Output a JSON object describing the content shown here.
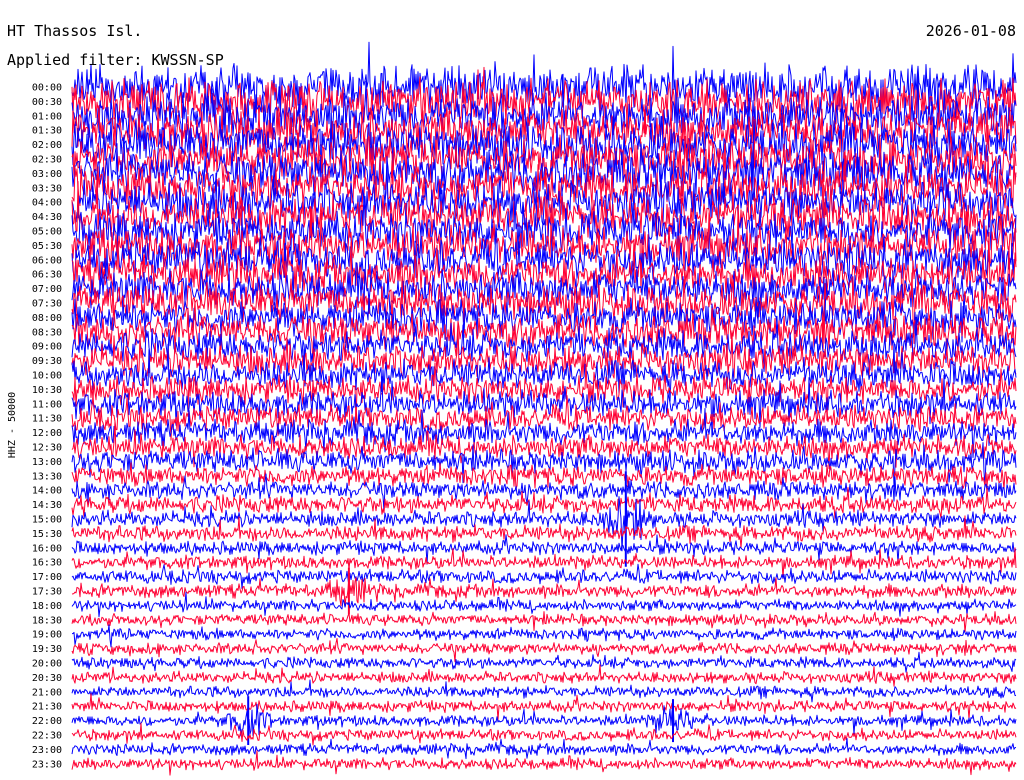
{
  "header": {
    "station": "HT Thassos Isl.",
    "date": "2026-01-08",
    "filter": "Applied filter: KWSSN-SP"
  },
  "chart_data": {
    "type": "line",
    "title": "HT Thassos Isl.",
    "ylabel": "HHZ - 50000",
    "x_range_minutes": [
      0,
      30
    ],
    "colors": [
      "#0000ff",
      "#ff0033"
    ],
    "rows": [
      {
        "label": "00:00",
        "color": "#0000ff",
        "amplitude": 0.95,
        "events": []
      },
      {
        "label": "00:30",
        "color": "#ff0033",
        "amplitude": 0.95,
        "events": []
      },
      {
        "label": "01:00",
        "color": "#0000ff",
        "amplitude": 0.95,
        "events": []
      },
      {
        "label": "01:30",
        "color": "#ff0033",
        "amplitude": 0.95,
        "events": []
      },
      {
        "label": "02:00",
        "color": "#0000ff",
        "amplitude": 0.95,
        "events": []
      },
      {
        "label": "02:30",
        "color": "#ff0033",
        "amplitude": 0.95,
        "events": []
      },
      {
        "label": "03:00",
        "color": "#0000ff",
        "amplitude": 0.95,
        "events": []
      },
      {
        "label": "03:30",
        "color": "#ff0033",
        "amplitude": 0.9,
        "events": []
      },
      {
        "label": "04:00",
        "color": "#0000ff",
        "amplitude": 0.9,
        "events": []
      },
      {
        "label": "04:30",
        "color": "#ff0033",
        "amplitude": 0.9,
        "events": []
      },
      {
        "label": "05:00",
        "color": "#0000ff",
        "amplitude": 0.85,
        "events": []
      },
      {
        "label": "05:30",
        "color": "#ff0033",
        "amplitude": 0.85,
        "events": []
      },
      {
        "label": "06:00",
        "color": "#0000ff",
        "amplitude": 0.85,
        "events": []
      },
      {
        "label": "06:30",
        "color": "#ff0033",
        "amplitude": 0.8,
        "events": []
      },
      {
        "label": "07:00",
        "color": "#0000ff",
        "amplitude": 0.8,
        "events": []
      },
      {
        "label": "07:30",
        "color": "#ff0033",
        "amplitude": 0.8,
        "events": []
      },
      {
        "label": "08:00",
        "color": "#0000ff",
        "amplitude": 0.75,
        "events": []
      },
      {
        "label": "08:30",
        "color": "#ff0033",
        "amplitude": 0.75,
        "events": []
      },
      {
        "label": "09:00",
        "color": "#0000ff",
        "amplitude": 0.7,
        "events": []
      },
      {
        "label": "09:30",
        "color": "#ff0033",
        "amplitude": 0.7,
        "events": []
      },
      {
        "label": "10:00",
        "color": "#0000ff",
        "amplitude": 0.65,
        "events": []
      },
      {
        "label": "10:30",
        "color": "#ff0033",
        "amplitude": 0.6,
        "events": []
      },
      {
        "label": "11:00",
        "color": "#0000ff",
        "amplitude": 0.6,
        "events": []
      },
      {
        "label": "11:30",
        "color": "#ff0033",
        "amplitude": 0.55,
        "events": []
      },
      {
        "label": "12:00",
        "color": "#0000ff",
        "amplitude": 0.55,
        "events": []
      },
      {
        "label": "12:30",
        "color": "#ff0033",
        "amplitude": 0.5,
        "events": []
      },
      {
        "label": "13:00",
        "color": "#0000ff",
        "amplitude": 0.5,
        "events": []
      },
      {
        "label": "13:30",
        "color": "#ff0033",
        "amplitude": 0.45,
        "events": []
      },
      {
        "label": "14:00",
        "color": "#0000ff",
        "amplitude": 0.4,
        "events": []
      },
      {
        "label": "14:30",
        "color": "#ff0033",
        "amplitude": 0.4,
        "events": []
      },
      {
        "label": "15:00",
        "color": "#0000ff",
        "amplitude": 0.35,
        "events": [
          {
            "minute": 17.6,
            "scale": 3.5
          }
        ]
      },
      {
        "label": "15:30",
        "color": "#ff0033",
        "amplitude": 0.35,
        "events": []
      },
      {
        "label": "16:00",
        "color": "#0000ff",
        "amplitude": 0.3,
        "events": []
      },
      {
        "label": "16:30",
        "color": "#ff0033",
        "amplitude": 0.3,
        "events": []
      },
      {
        "label": "17:00",
        "color": "#0000ff",
        "amplitude": 0.3,
        "events": []
      },
      {
        "label": "17:30",
        "color": "#ff0033",
        "amplitude": 0.3,
        "events": [
          {
            "minute": 8.8,
            "scale": 2.0
          }
        ]
      },
      {
        "label": "18:00",
        "color": "#0000ff",
        "amplitude": 0.25,
        "events": []
      },
      {
        "label": "18:30",
        "color": "#ff0033",
        "amplitude": 0.25,
        "events": []
      },
      {
        "label": "19:00",
        "color": "#0000ff",
        "amplitude": 0.25,
        "events": []
      },
      {
        "label": "19:30",
        "color": "#ff0033",
        "amplitude": 0.25,
        "events": []
      },
      {
        "label": "20:00",
        "color": "#0000ff",
        "amplitude": 0.25,
        "events": []
      },
      {
        "label": "20:30",
        "color": "#ff0033",
        "amplitude": 0.25,
        "events": []
      },
      {
        "label": "21:00",
        "color": "#0000ff",
        "amplitude": 0.25,
        "events": []
      },
      {
        "label": "21:30",
        "color": "#ff0033",
        "amplitude": 0.25,
        "events": []
      },
      {
        "label": "22:00",
        "color": "#0000ff",
        "amplitude": 0.25,
        "events": [
          {
            "minute": 5.6,
            "scale": 2.5
          },
          {
            "minute": 19.1,
            "scale": 2.2
          }
        ]
      },
      {
        "label": "22:30",
        "color": "#ff0033",
        "amplitude": 0.25,
        "events": []
      },
      {
        "label": "23:00",
        "color": "#0000ff",
        "amplitude": 0.25,
        "events": []
      },
      {
        "label": "23:30",
        "color": "#ff0033",
        "amplitude": 0.25,
        "events": []
      }
    ]
  }
}
